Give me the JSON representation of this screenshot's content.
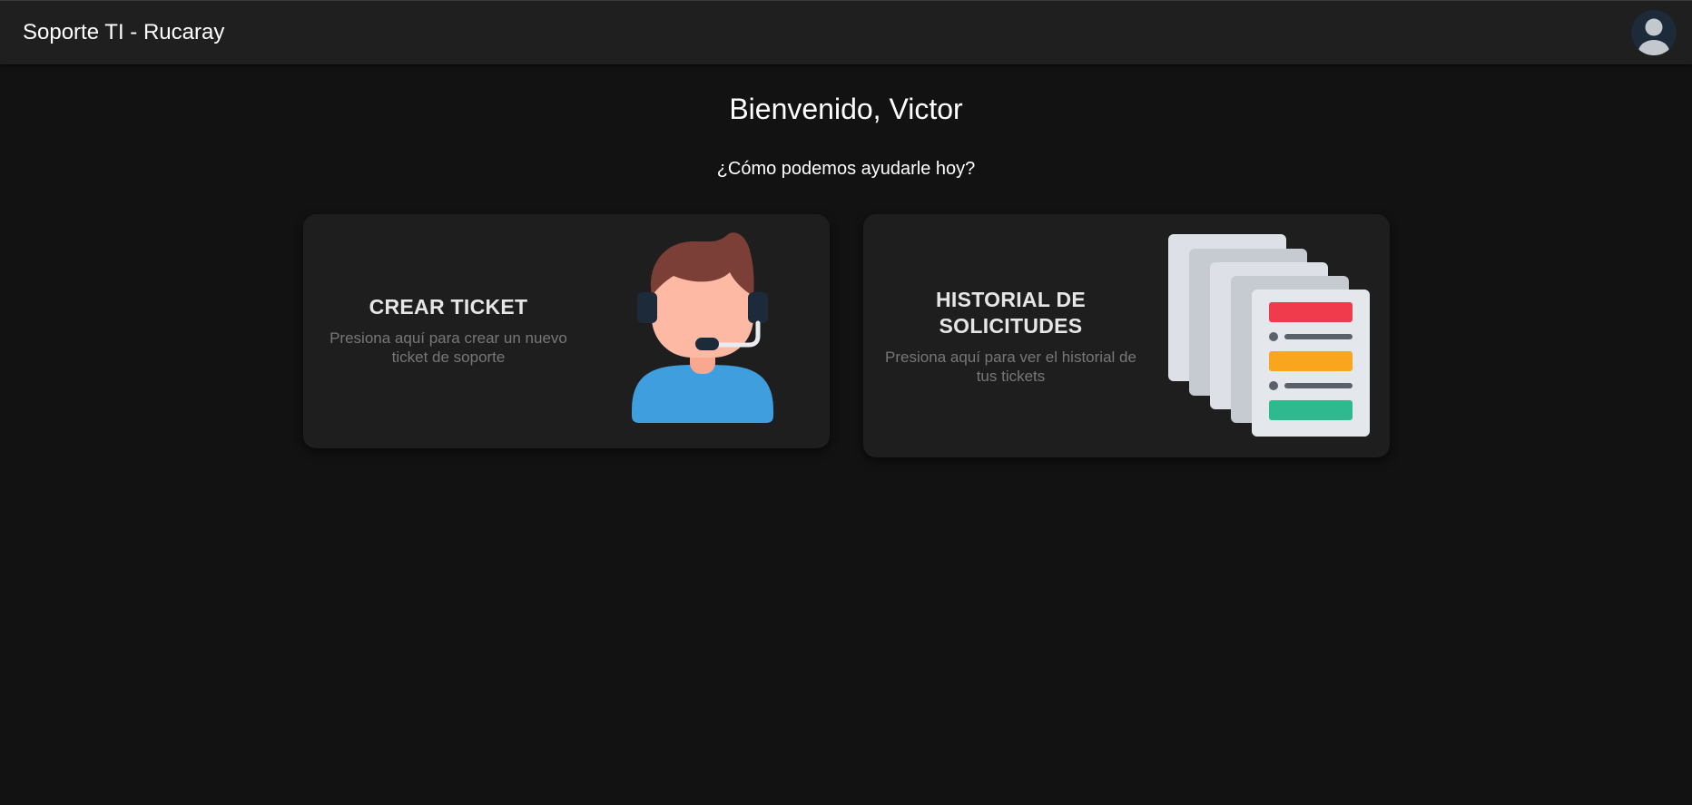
{
  "header": {
    "title": "Soporte TI - Rucaray",
    "avatar_icon": "user-avatar-icon"
  },
  "main": {
    "welcome": "Bienvenido, Victor",
    "subtitle": "¿Cómo podemos ayudarle hoy?",
    "cards": [
      {
        "title": "CREAR TICKET",
        "description": "Presiona aquí para crear un nuevo ticket de soporte",
        "icon": "support-agent-icon"
      },
      {
        "title": "HISTORIAL DE SOLICITUDES",
        "description": "Presiona aquí para ver el historial de tus tickets",
        "icon": "documents-history-icon"
      }
    ]
  },
  "colors": {
    "background": "#121212",
    "topbar": "#1f1f1f",
    "card": "#1e1e1e",
    "doc_red": "#ef3b4b",
    "doc_orange": "#f9a51d",
    "doc_green": "#2fb98f",
    "agent_shirt": "#3f9edd",
    "agent_hair": "#7b3f37"
  }
}
